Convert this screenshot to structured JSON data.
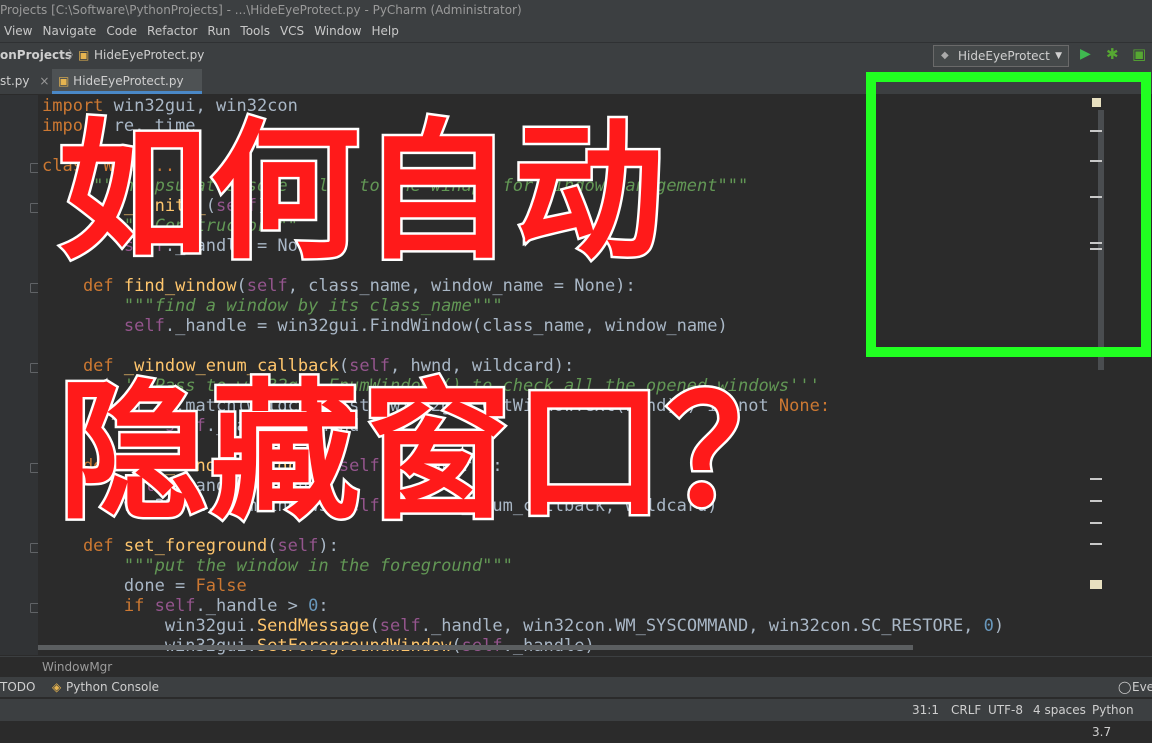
{
  "titlebar": {
    "text": "Projects [C:\\Software\\PythonProjects] - ...\\HideEyeProtect.py - PyCharm (Administrator)"
  },
  "menu": [
    "View",
    "Navigate",
    "Code",
    "Refactor",
    "Run",
    "Tools",
    "VCS",
    "Window",
    "Help"
  ],
  "breadcrumb": {
    "project": "onProjects",
    "file": "HideEyeProtect.py"
  },
  "run_config": {
    "label": "HideEyeProtect",
    "run_icon": "play-icon",
    "debug_icon": "bug-icon",
    "colors": {
      "run": "#3fb950",
      "debug": "#56a832"
    }
  },
  "tabs": [
    {
      "label": "st.py"
    },
    {
      "label": "HideEyeProtect.py",
      "active": true
    }
  ],
  "code_lines": {
    "l1": [
      "import",
      " win32gui, win32con"
    ],
    "l2": [
      "import",
      " re, time"
    ],
    "l3": [
      "cla",
      "ss Wind..."
    ],
    "l4": [
      "    \"\"\"Encapsulates some calls to the winapi for window management\"\"\""
    ],
    "l5": [
      "    def",
      " __init__",
      "(",
      "self",
      "):"
    ],
    "l6": [
      "        \"\"\"Constructor\"\"\""
    ],
    "l7": [
      "        ",
      "self",
      "._handle = None"
    ],
    "l8": [
      "    def",
      " find_window",
      "(",
      "self",
      ", class_name, window_name = None):"
    ],
    "l9": [
      "        \"\"\"find a window by its class_name\"\"\""
    ],
    "l10": [
      "        ",
      "self",
      "._handle = win32gui.FindWindow(class_name, window_name)"
    ],
    "l11": [
      "    def",
      " _window_enum_callback",
      "(",
      "self",
      ", hwnd, wildcard):"
    ],
    "l12": [
      "        '''Pass to win32gui.EnumWindows() to check all the opened windows'''"
    ],
    "l13": [
      "        if re.match(wildcard, str(win32gui.GetWindowText(hwnd))) is not",
      " None:"
    ],
    "l14": [
      "            ",
      "self",
      "._handle = hwnd"
    ],
    "l15": [
      "    def",
      " find_window_wildcard",
      "(",
      "self",
      ", wildcard):"
    ],
    "l16": [
      "        ",
      "self",
      "._handle = None"
    ],
    "l17": [
      "        win32gui.EnumWindows(",
      "self",
      "._window_enum_callback, wildcard)"
    ],
    "l18": [
      "    def",
      " set_foreground",
      "(",
      "self",
      "):"
    ],
    "l19": [
      "        \"\"\"put the window in the foreground\"\"\""
    ],
    "l20": [
      "        done = ",
      "False"
    ],
    "l21": [
      "        if ",
      "self",
      "._handle > ",
      "0",
      ":"
    ],
    "l22": [
      "            win32gui.",
      "SendMessage",
      "(",
      "self",
      "._handle, win32con.WM_SYSCOMMAND, win32con.SC_RESTORE, ",
      "0",
      ")"
    ],
    "l23": [
      "            win32gui.",
      "SetForegroundWindow",
      "(",
      "self",
      "._handle)"
    ]
  },
  "structure_crumb": "WindowMgr",
  "tool_windows": {
    "todo": "TODO",
    "console": "Python Console",
    "event": "Eve"
  },
  "status": {
    "position": "31:1",
    "line_sep": "CRLF",
    "encoding": "UTF-8",
    "indent": "4 spaces",
    "interpreter": "Python 3.7"
  },
  "overlay": {
    "line1": "如何自动",
    "line2": "隐藏窗口？",
    "text_color": "#ff1a1a",
    "stroke_color": "#ffffff",
    "box_color": "#21ff21"
  }
}
